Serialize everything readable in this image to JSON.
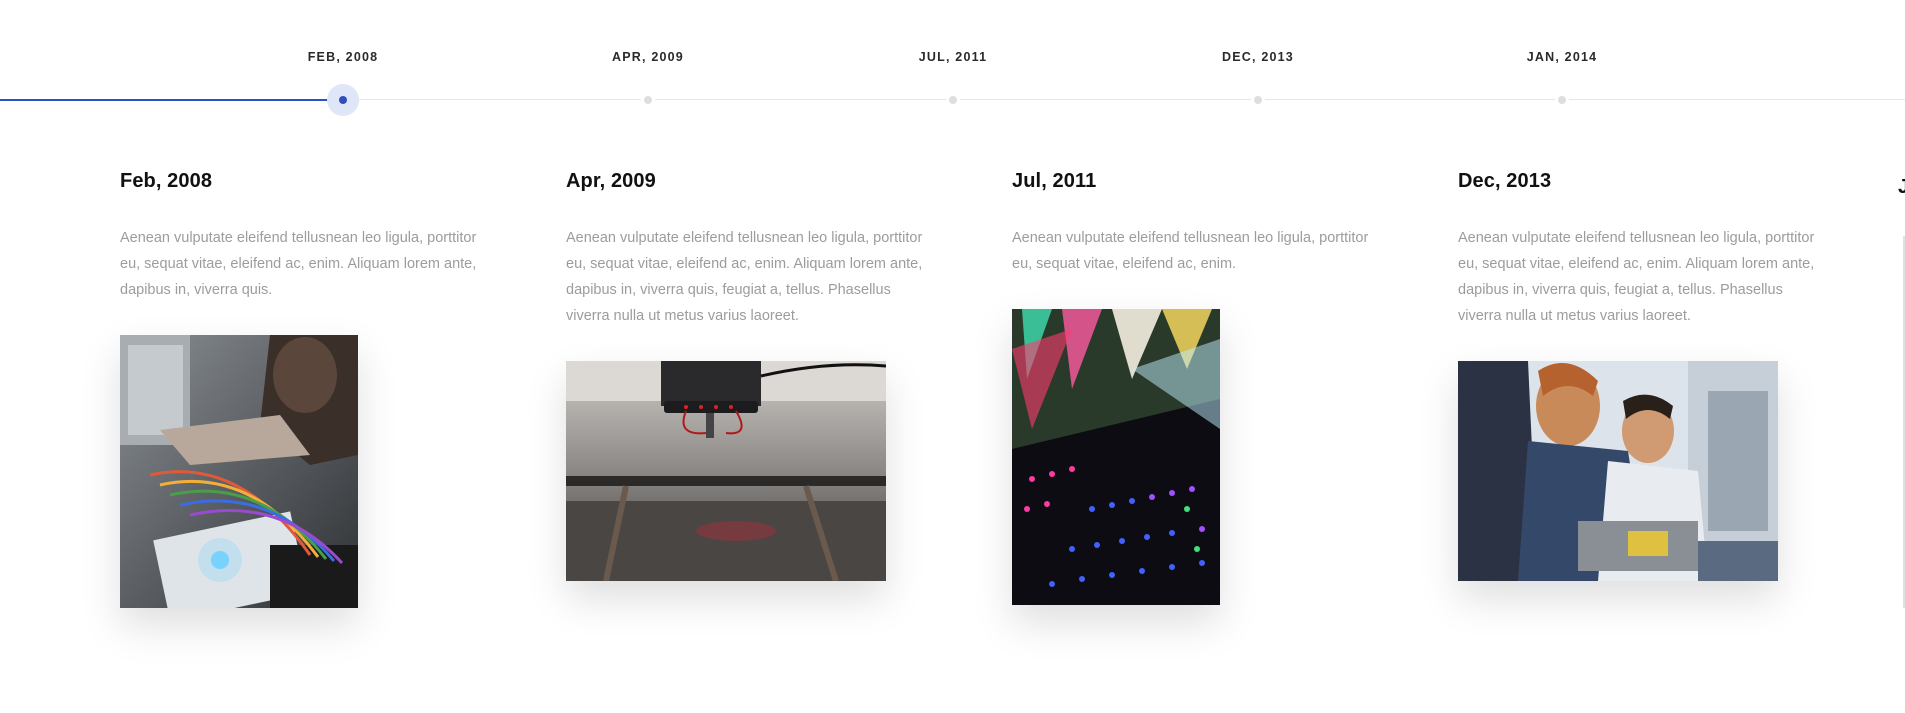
{
  "timeline": {
    "stops": [
      {
        "label": "FEB, 2008",
        "active": true
      },
      {
        "label": "APR, 2009",
        "active": false
      },
      {
        "label": "JUL, 2011",
        "active": false
      },
      {
        "label": "DEC, 2013",
        "active": false
      },
      {
        "label": "JAN, 2014",
        "active": false
      }
    ],
    "accent_color": "#2e4fbf"
  },
  "events": [
    {
      "title": "Feb, 2008",
      "text": "Aenean vulputate eleifend tellusnean leo ligula, porttitor eu, sequat vitae, eleifend ac, enim. Aliquam lorem ante, dapibus in, viverra quis.",
      "image": "electronics-breadboard-photo"
    },
    {
      "title": "Apr, 2009",
      "text": "Aenean vulputate eleifend tellusnean leo ligula, porttitor eu, sequat vitae, eleifend ac, enim. Aliquam lorem ante, dapibus in, viverra quis, feugiat a, tellus. Phasellus viverra nulla ut metus varius laoreet.",
      "image": "cnc-machine-photo"
    },
    {
      "title": "Jul, 2011",
      "text": "Aenean vulputate eleifend tellusnean leo ligula, porttitor eu, sequat vitae, eleifend ac, enim.",
      "image": "led-lights-photo"
    },
    {
      "title": "Dec, 2013",
      "text": "Aenean vulputate eleifend tellusnean leo ligula, porttitor eu, sequat vitae, eleifend ac, enim. Aliquam lorem ante, dapibus in, viverra quis, feugiat a, tellus. Phasellus viverra nulla ut metus varius laoreet.",
      "image": "engineers-workshop-photo"
    }
  ]
}
